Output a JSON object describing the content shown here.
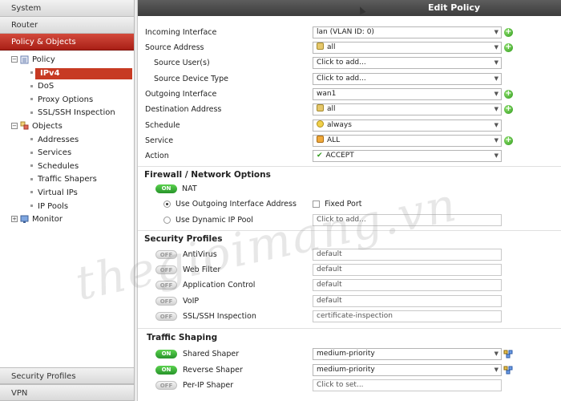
{
  "sidebar": {
    "top": [
      "System",
      "Router",
      "Policy & Objects"
    ],
    "policy_label": "Policy",
    "policy_items": [
      "IPv4",
      "DoS",
      "Proxy Options",
      "SSL/SSH Inspection"
    ],
    "objects_label": "Objects",
    "objects_items": [
      "Addresses",
      "Services",
      "Schedules",
      "Traffic Shapers",
      "Virtual IPs",
      "IP Pools"
    ],
    "monitor_label": "Monitor",
    "bottom": [
      "Security Profiles",
      "VPN"
    ]
  },
  "title": "Edit Policy",
  "form": {
    "incoming": {
      "label": "Incoming Interface",
      "value": "lan (VLAN ID: 0)"
    },
    "source": {
      "label": "Source Address",
      "value": "all"
    },
    "source_user": {
      "label": "Source User(s)",
      "value": "Click to add..."
    },
    "source_device": {
      "label": "Source Device Type",
      "value": "Click to add..."
    },
    "outgoing": {
      "label": "Outgoing Interface",
      "value": "wan1"
    },
    "destination": {
      "label": "Destination Address",
      "value": "all"
    },
    "schedule": {
      "label": "Schedule",
      "value": "always"
    },
    "service": {
      "label": "Service",
      "value": "ALL"
    },
    "action": {
      "label": "Action",
      "value": "ACCEPT"
    }
  },
  "firewall": {
    "title": "Firewall / Network Options",
    "nat_label": "NAT",
    "nat_toggle": "ON",
    "use_outgoing": "Use Outgoing Interface Address",
    "fixed_port": "Fixed Port",
    "use_dynamic": "Use Dynamic IP Pool",
    "pool_placeholder": "Click to add..."
  },
  "security": {
    "title": "Security Profiles",
    "items": [
      {
        "label": "AntiVirus",
        "state": "OFF",
        "value": "default"
      },
      {
        "label": "Web Filter",
        "state": "OFF",
        "value": "default"
      },
      {
        "label": "Application Control",
        "state": "OFF",
        "value": "default"
      },
      {
        "label": "VoIP",
        "state": "OFF",
        "value": "default"
      },
      {
        "label": "SSL/SSH Inspection",
        "state": "OFF",
        "value": "certificate-inspection"
      }
    ]
  },
  "shaping": {
    "title": "Traffic Shaping",
    "shared": {
      "label": "Shared Shaper",
      "state": "ON",
      "value": "medium-priority"
    },
    "reverse": {
      "label": "Reverse Shaper",
      "state": "ON",
      "value": "medium-priority"
    },
    "perip": {
      "label": "Per-IP Shaper",
      "state": "OFF",
      "value": "Click to set..."
    }
  },
  "watermark": "thegioimang.vn",
  "colors": {
    "accent": "#c73a23",
    "green": "#2f9a1b"
  }
}
